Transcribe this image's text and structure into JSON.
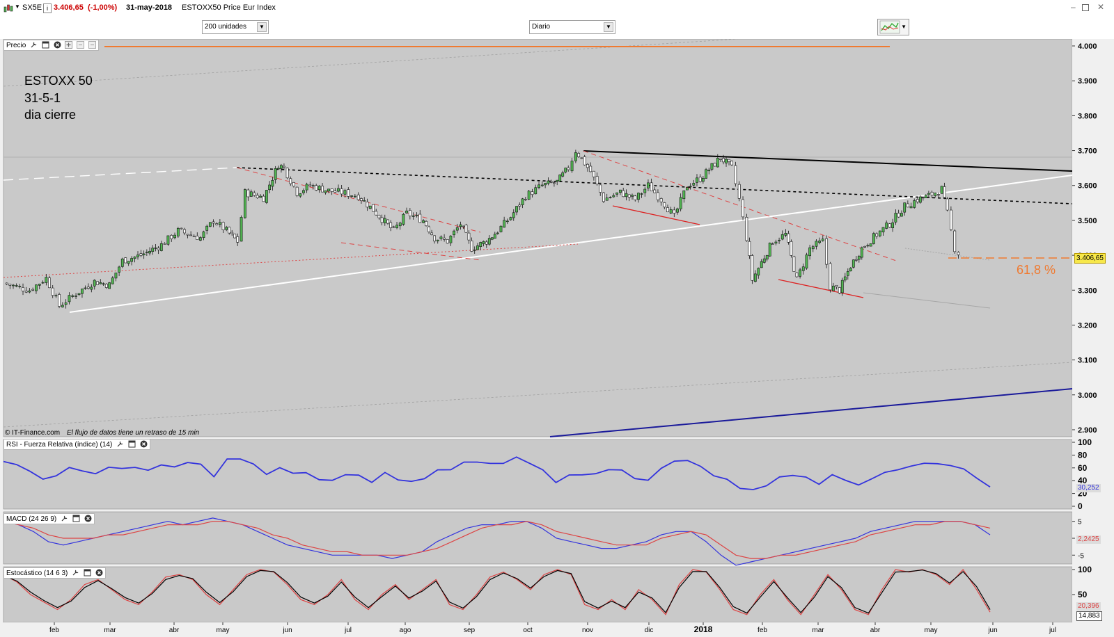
{
  "window": {
    "symbol": "SX5E",
    "last_price": "3.406,65",
    "change": "(-1,00%)",
    "date": "31-may-2018",
    "instrument": "ESTOXX50 Price Eur Index"
  },
  "toolbar": {
    "units_value": "200 unidades",
    "interval_value": "Diario"
  },
  "panels": {
    "price": {
      "label": "Precio"
    },
    "rsi": {
      "label": "RSI - Fuerza Relativa (índice) (14)"
    },
    "macd": {
      "label": "MACD (24 26 9)"
    },
    "stoch": {
      "label": "Estocástico (14 6 3)"
    }
  },
  "annotations": {
    "note_line1": "ESTOXX 50",
    "note_line2": "31-5-1",
    "note_line3": "dia cierre",
    "fib_label": "61,8 %",
    "copyright": "© IT-Finance.com",
    "delay_notice": "El flujo de datos tiene un retraso de 15 min"
  },
  "colors": {
    "panel_bg": "#c9c9c9",
    "bull_candle": "#52b552",
    "bear_candle": "#ffffff",
    "rsi_line": "#3333dd",
    "macd_line": "#3333dd",
    "signal_line": "#dd4444",
    "fib_line": "#f07a30",
    "support_line": "#ffffff",
    "resistance_line": "#000000",
    "channel_line": "#1a1a9a"
  },
  "chart_data": [
    {
      "type": "candlestick",
      "panel": "price",
      "ylim": [
        2880,
        4020
      ],
      "y_ticks": [
        "4.000",
        "3.900",
        "3.800",
        "3.700",
        "3.600",
        "3.500",
        "3.400",
        "3.300",
        "3.200",
        "3.100",
        "3.000",
        "2.900"
      ],
      "y_tick_values": [
        4000,
        3900,
        3800,
        3700,
        3600,
        3500,
        3400,
        3300,
        3200,
        3100,
        3000,
        2900
      ],
      "x_tick_labels": [
        "feb",
        "mar",
        "abr",
        "may",
        "jun",
        "jul",
        "ago",
        "sep",
        "oct",
        "nov",
        "dic",
        "2018",
        "feb",
        "mar",
        "abr",
        "may",
        "jun",
        "jul"
      ],
      "last_value_label": "3.406,65",
      "series_close": [
        [
          "2017-01-02",
          3320
        ],
        [
          "2017-01-16",
          3300
        ],
        [
          "2017-01-25",
          3335
        ],
        [
          "2017-02-01",
          3255
        ],
        [
          "2017-02-10",
          3290
        ],
        [
          "2017-02-20",
          3325
        ],
        [
          "2017-02-28",
          3315
        ],
        [
          "2017-03-07",
          3385
        ],
        [
          "2017-03-17",
          3400
        ],
        [
          "2017-03-28",
          3430
        ],
        [
          "2017-04-06",
          3470
        ],
        [
          "2017-04-18",
          3450
        ],
        [
          "2017-04-25",
          3500
        ],
        [
          "2017-05-02",
          3470
        ],
        [
          "2017-05-08",
          3440
        ],
        [
          "2017-05-12",
          3580
        ],
        [
          "2017-05-22",
          3565
        ],
        [
          "2017-05-30",
          3660
        ],
        [
          "2017-06-02",
          3650
        ],
        [
          "2017-06-09",
          3580
        ],
        [
          "2017-06-16",
          3600
        ],
        [
          "2017-06-26",
          3585
        ],
        [
          "2017-07-03",
          3580
        ],
        [
          "2017-07-12",
          3570
        ],
        [
          "2017-07-20",
          3530
        ],
        [
          "2017-07-31",
          3470
        ],
        [
          "2017-08-07",
          3520
        ],
        [
          "2017-08-16",
          3500
        ],
        [
          "2017-08-22",
          3450
        ],
        [
          "2017-08-29",
          3440
        ],
        [
          "2017-09-05",
          3490
        ],
        [
          "2017-09-11",
          3420
        ],
        [
          "2017-09-19",
          3440
        ],
        [
          "2017-09-25",
          3470
        ],
        [
          "2017-10-02",
          3510
        ],
        [
          "2017-10-10",
          3570
        ],
        [
          "2017-10-19",
          3600
        ],
        [
          "2017-10-27",
          3610
        ],
        [
          "2017-11-02",
          3650
        ],
        [
          "2017-11-06",
          3700
        ],
        [
          "2017-11-14",
          3640
        ],
        [
          "2017-11-21",
          3560
        ],
        [
          "2017-11-30",
          3580
        ],
        [
          "2017-12-08",
          3560
        ],
        [
          "2017-12-15",
          3600
        ],
        [
          "2017-12-22",
          3560
        ],
        [
          "2017-12-29",
          3510
        ],
        [
          "2018-01-05",
          3600
        ],
        [
          "2018-01-12",
          3620
        ],
        [
          "2018-01-23",
          3680
        ],
        [
          "2018-01-29",
          3650
        ],
        [
          "2018-02-02",
          3560
        ],
        [
          "2018-02-06",
          3450
        ],
        [
          "2018-02-09",
          3330
        ],
        [
          "2018-02-14",
          3380
        ],
        [
          "2018-02-20",
          3440
        ],
        [
          "2018-02-27",
          3460
        ],
        [
          "2018-03-05",
          3330
        ],
        [
          "2018-03-12",
          3420
        ],
        [
          "2018-03-19",
          3440
        ],
        [
          "2018-03-23",
          3310
        ],
        [
          "2018-03-28",
          3300
        ],
        [
          "2018-04-03",
          3370
        ],
        [
          "2018-04-09",
          3420
        ],
        [
          "2018-04-17",
          3460
        ],
        [
          "2018-04-24",
          3490
        ],
        [
          "2018-05-02",
          3540
        ],
        [
          "2018-05-09",
          3560
        ],
        [
          "2018-05-15",
          3570
        ],
        [
          "2018-05-22",
          3590
        ],
        [
          "2018-05-25",
          3520
        ],
        [
          "2018-05-29",
          3420
        ],
        [
          "2018-05-31",
          3406.65
        ]
      ]
    },
    {
      "type": "line",
      "panel": "rsi",
      "ylim": [
        0,
        100
      ],
      "y_ticks": [
        "100",
        "80",
        "60",
        "40",
        "20",
        "0"
      ],
      "y_tick_values": [
        100,
        80,
        60,
        40,
        20,
        0
      ],
      "last_value_label": "30,252",
      "series": [
        {
          "values": [
            70,
            65,
            55,
            42,
            48,
            60,
            56,
            50,
            62,
            58,
            62,
            55,
            66,
            60,
            70,
            64,
            48,
            72,
            76,
            64,
            52,
            58,
            54,
            50,
            44,
            38,
            52,
            46,
            40,
            50,
            44,
            36,
            46,
            54,
            60,
            66,
            72,
            64,
            70,
            74,
            70,
            54,
            40,
            46,
            52,
            48,
            60,
            54,
            46,
            38,
            62,
            68,
            74,
            60,
            50,
            40,
            30,
            24,
            34,
            44,
            50,
            44,
            36,
            48,
            42,
            32,
            44,
            52,
            58,
            62,
            68,
            66,
            64,
            58,
            44,
            30
          ]
        }
      ]
    },
    {
      "type": "line",
      "panel": "macd",
      "ylim": [
        -7,
        7
      ],
      "y_ticks": [
        "5",
        "0",
        "-5"
      ],
      "y_tick_values": [
        5,
        0,
        -5
      ],
      "last_value_label": "2,2425",
      "series": [
        {
          "values": [
            5,
            4,
            2,
            -1,
            -2,
            -1,
            0,
            1,
            2,
            3,
            4,
            5,
            4,
            5,
            6,
            5,
            4,
            2,
            0,
            -2,
            -3,
            -4,
            -5,
            -5,
            -5,
            -5,
            -6,
            -5,
            -4,
            -1,
            1,
            3,
            4,
            4,
            5,
            5,
            3,
            0,
            -1,
            -2,
            -3,
            -3,
            -2,
            -1,
            1,
            2,
            2,
            -1,
            -5,
            -8,
            -7,
            -6,
            -5,
            -4,
            -3,
            -2,
            -1,
            0,
            2,
            3,
            4,
            5,
            5,
            5,
            5,
            4,
            1
          ]
        },
        {
          "values": [
            5,
            4,
            3,
            1,
            0,
            0,
            0,
            1,
            1,
            2,
            3,
            4,
            4,
            4,
            5,
            5,
            4,
            3,
            1,
            0,
            -2,
            -3,
            -4,
            -4,
            -5,
            -5,
            -5,
            -5,
            -4,
            -3,
            -1,
            1,
            3,
            4,
            4,
            5,
            4,
            2,
            1,
            0,
            -1,
            -2,
            -2,
            -2,
            0,
            1,
            2,
            1,
            -2,
            -5,
            -6,
            -6,
            -5,
            -5,
            -4,
            -3,
            -2,
            -1,
            1,
            2,
            3,
            4,
            4,
            5,
            5,
            4,
            3
          ]
        }
      ]
    },
    {
      "type": "line",
      "panel": "stoch",
      "ylim": [
        0,
        100
      ],
      "y_ticks": [
        "100",
        "50"
      ],
      "y_tick_values": [
        100,
        50
      ],
      "last_value_labels": [
        "20,396",
        "14,883"
      ],
      "series": [
        {
          "values": [
            90,
            75,
            50,
            35,
            20,
            40,
            70,
            80,
            60,
            40,
            30,
            55,
            85,
            90,
            80,
            50,
            30,
            60,
            90,
            100,
            95,
            70,
            40,
            30,
            50,
            80,
            40,
            20,
            50,
            70,
            40,
            60,
            80,
            30,
            20,
            50,
            85,
            95,
            80,
            60,
            90,
            100,
            90,
            30,
            20,
            40,
            20,
            60,
            40,
            10,
            70,
            100,
            95,
            60,
            20,
            10,
            50,
            80,
            40,
            10,
            50,
            90,
            60,
            20,
            10,
            60,
            100,
            95,
            100,
            90,
            70,
            100,
            60,
            15
          ]
        },
        {
          "values": [
            88,
            77,
            55,
            38,
            24,
            37,
            64,
            78,
            62,
            44,
            33,
            52,
            80,
            88,
            82,
            55,
            34,
            56,
            86,
            98,
            96,
            74,
            45,
            33,
            47,
            75,
            45,
            24,
            46,
            67,
            43,
            57,
            77,
            35,
            23,
            46,
            80,
            93,
            82,
            63,
            86,
            98,
            92,
            36,
            23,
            37,
            24,
            55,
            43,
            14,
            64,
            96,
            96,
            64,
            26,
            13,
            45,
            76,
            44,
            14,
            45,
            86,
            64,
            24,
            13,
            54,
            95,
            96,
            99,
            92,
            73,
            96,
            66,
            20
          ]
        }
      ]
    }
  ]
}
